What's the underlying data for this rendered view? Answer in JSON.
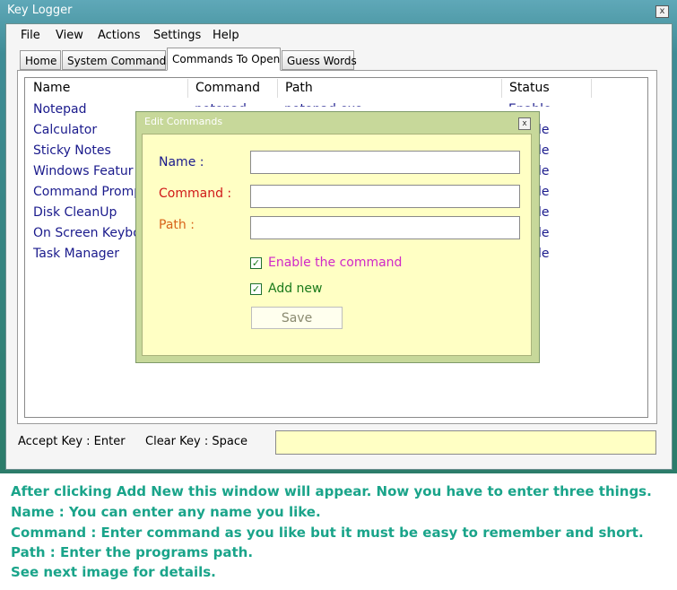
{
  "window": {
    "title": "Key Logger",
    "close_glyph": "x"
  },
  "menu": [
    "File",
    "View",
    "Actions",
    "Settings",
    "Help"
  ],
  "tabs": [
    "Home",
    "System Commands",
    "Commands To Open",
    "Guess Words"
  ],
  "active_tab": "Commands To Open",
  "list": {
    "columns": [
      "Name",
      "Command",
      "Path",
      "Status"
    ],
    "rows": [
      {
        "name": "Notepad",
        "status": "Enable"
      },
      {
        "name": "Calculator",
        "status": "le"
      },
      {
        "name": "Sticky Notes",
        "status": "le"
      },
      {
        "name": "Windows Featur",
        "status": "le"
      },
      {
        "name": "Command Promp",
        "status": "le"
      },
      {
        "name": "Disk CleanUp",
        "status": "le"
      },
      {
        "name": "On Screen Keybo",
        "status": "le"
      },
      {
        "name": "Task Manager",
        "status": "le"
      }
    ],
    "partial_command": "notepad",
    "partial_path": "notepad.exe"
  },
  "bottom": {
    "accept": "Accept Key : Enter",
    "clear": "Clear Key : Space",
    "key_value": ""
  },
  "dialog": {
    "title": "Edit Commands",
    "close_glyph": "x",
    "name_label": "Name :",
    "command_label": "Command :",
    "path_label": "Path :",
    "name_value": "",
    "command_value": "",
    "path_value": "",
    "enable_label": "Enable the command",
    "enable_checked": true,
    "addnew_label": "Add new",
    "addnew_checked": true,
    "save_label": "Save",
    "check_glyph": "✓"
  },
  "caption": [
    "After clicking Add New this window will appear. Now you have to enter three things.",
    "Name : You can enter any name you like.",
    "Command : Enter command as you like but it must be easy to remember and short.",
    "Path : Enter the programs path.",
    "See next image for details."
  ],
  "colors": {
    "dialog_bg": "#ffffc4",
    "name_label": "#1a1a8c",
    "command_label": "#d01818",
    "path_label": "#d8641a",
    "enable_label": "#d028c8",
    "addnew_label": "#1a7a1a",
    "caption": "#1aa48a"
  }
}
